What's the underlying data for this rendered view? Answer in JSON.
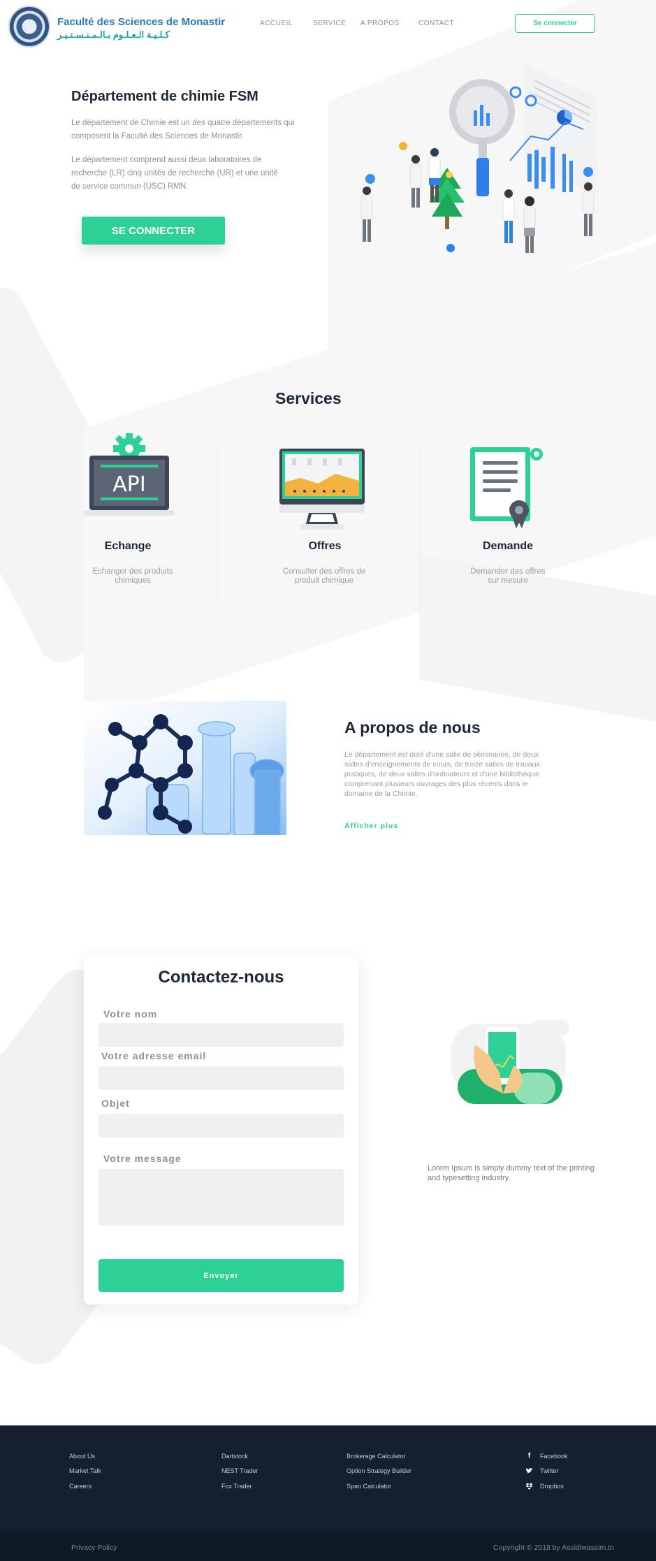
{
  "header": {
    "logo_fr": "Faculté des Sciences de Monastir",
    "logo_ar": "كـلـيـة الـعـلـوم بـالـمـنـسـتـيـر",
    "nav": [
      "ACCUEIL",
      "SERVICE",
      "A PROPOS",
      "CONTACT"
    ],
    "login_label": "Se connecter"
  },
  "hero": {
    "title": "Département de chimie FSM",
    "p1": "Le département de Chimie est un des quatre départements qui composent la Faculté des Sciences de Monastir.",
    "p2": "Le département comprend aussi deux laboratoires de recherche (LR) cinq unités de recherche (UR) et une unité de service commun (USC) RMN.",
    "cta": "SE CONNECTER"
  },
  "services": {
    "title": "Services",
    "items": [
      {
        "name": "Echange",
        "desc": "Echanger des produits chimiques",
        "icon": "api-laptop-icon",
        "icon_text": "API"
      },
      {
        "name": "Offres",
        "desc": "Consulter des offres de produit chimique",
        "icon": "monitor-chart-icon"
      },
      {
        "name": "Demande",
        "desc": "Demander des offres sur mesure",
        "icon": "certificate-document-icon"
      }
    ]
  },
  "about": {
    "title": "A propos de nous",
    "text": "Le département est doté d'une salle de séminaires, de deux salles d'enseignements de cours, de treize salles de travaux pratiques, de deux salles d'ordinateurs et d'une bibliothèque comprenant plusieurs ouvrages des plus récents dans le domaine de la Chimie.",
    "link": "Afficher plus"
  },
  "contact": {
    "title": "Contactez-nous",
    "labels": {
      "name": "Votre nom",
      "email": "Votre adresse email",
      "subject": "Objet",
      "message": "Votre message"
    },
    "submit": "Envoyer",
    "side_text": "Lorem Ipsum is simply dummy text of the printing and typesetting industry."
  },
  "footer": {
    "col1": [
      "About Us",
      "Market Talk",
      "Careers"
    ],
    "col2": [
      "Dartstock",
      "NEST Trader",
      "Fox Trader"
    ],
    "col3": [
      "Brokerage Calculator",
      "Option Strategy Builder",
      "Span Calculator"
    ],
    "social": [
      {
        "label": "Facebook",
        "icon": "facebook-icon"
      },
      {
        "label": "Twitter",
        "icon": "twitter-icon"
      },
      {
        "label": "Dropbox",
        "icon": "dropbox-icon"
      }
    ],
    "privacy": "Privacy Policy",
    "copyright": "Copyright © 2018 by Assidiwassim.tn"
  },
  "colors": {
    "accent": "#2dd196",
    "dark": "#14202f",
    "title": "#1c2737",
    "muted": "#9a9da3"
  }
}
